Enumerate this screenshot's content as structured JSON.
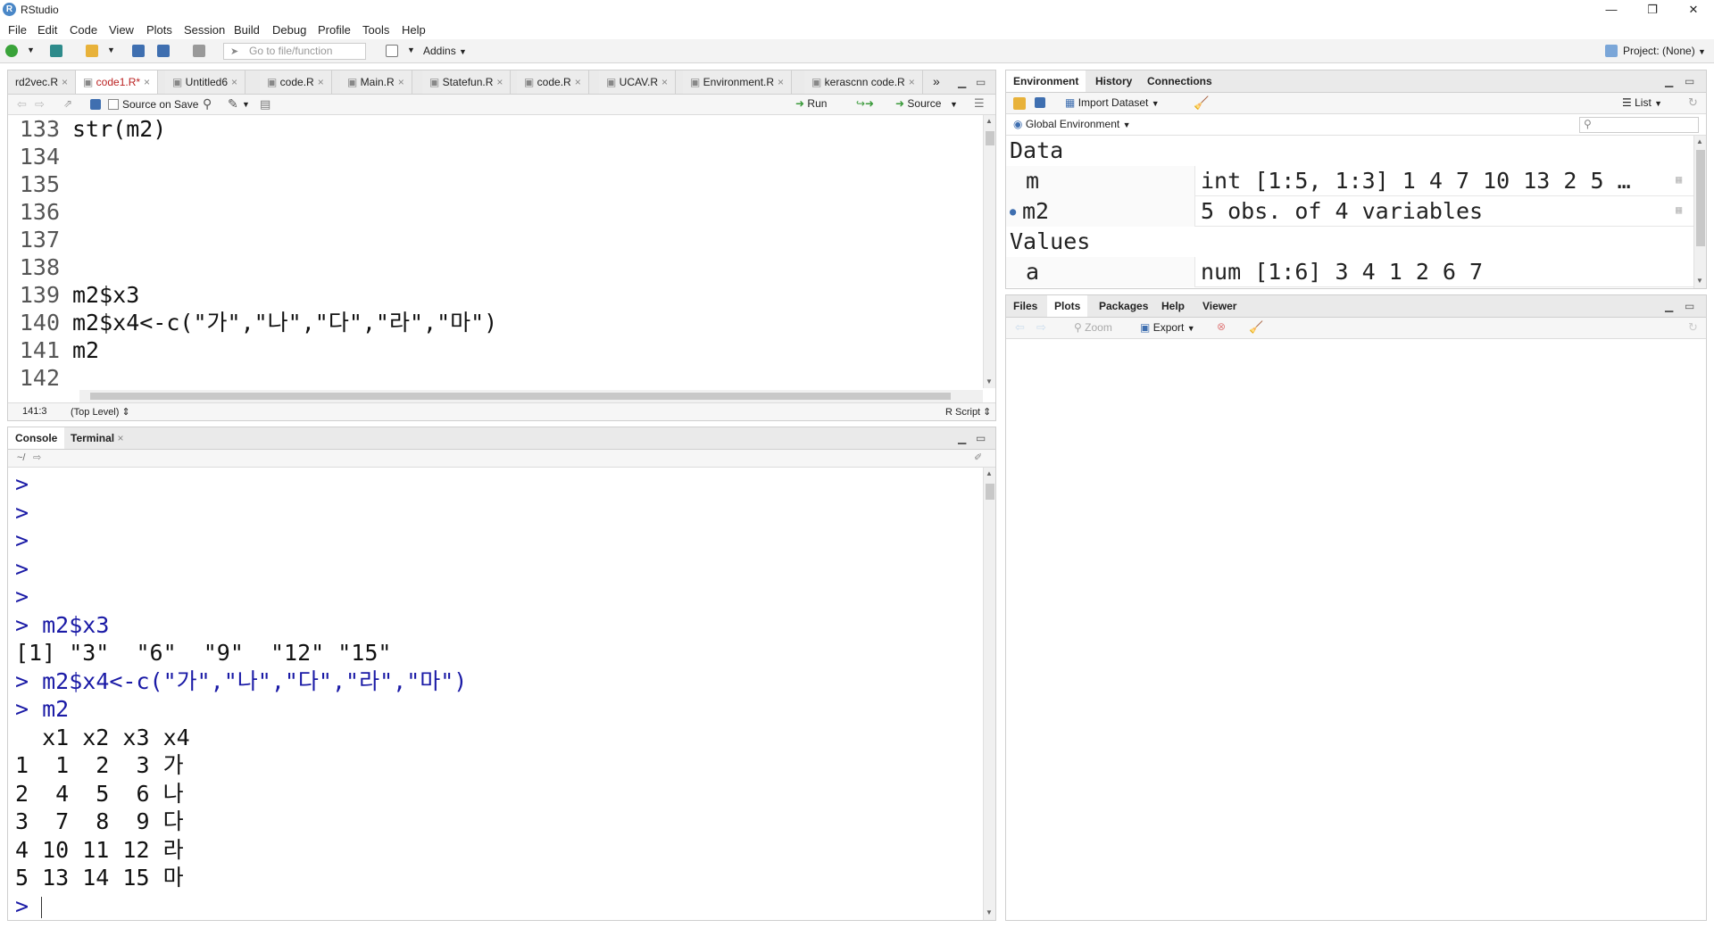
{
  "window": {
    "title": "RStudio",
    "logo": "R"
  },
  "menu": [
    "File",
    "Edit",
    "Code",
    "View",
    "Plots",
    "Session",
    "Build",
    "Debug",
    "Profile",
    "Tools",
    "Help"
  ],
  "toolbar": {
    "goto_placeholder": "Go to file/function",
    "addins": "Addins",
    "project": "Project: (None)"
  },
  "editor": {
    "tabs": [
      {
        "label": "rd2vec.R",
        "active": false
      },
      {
        "label": "code1.R*",
        "active": true
      },
      {
        "label": "Untitled6",
        "active": false
      },
      {
        "label": "code.R",
        "active": false
      },
      {
        "label": "Main.R",
        "active": false
      },
      {
        "label": "Statefun.R",
        "active": false
      },
      {
        "label": "code.R",
        "active": false
      },
      {
        "label": "UCAV.R",
        "active": false
      },
      {
        "label": "Environment.R",
        "active": false
      },
      {
        "label": "kerascnn code.R",
        "active": false
      }
    ],
    "source_on_save": "Source on Save",
    "run": "Run",
    "source": "Source",
    "lines": [
      {
        "n": "133",
        "code": "str(m2)"
      },
      {
        "n": "134",
        "code": ""
      },
      {
        "n": "135",
        "code": ""
      },
      {
        "n": "136",
        "code": ""
      },
      {
        "n": "137",
        "code": ""
      },
      {
        "n": "138",
        "code": ""
      },
      {
        "n": "139",
        "code": "m2$x3"
      },
      {
        "n": "140",
        "code": "m2$x4<-c(\"가\",\"나\",\"다\",\"라\",\"마\")"
      },
      {
        "n": "141",
        "code": "m2"
      },
      {
        "n": "142",
        "code": ""
      }
    ],
    "status": {
      "position": "141:3",
      "scope": "(Top Level)",
      "filetype": "R Script"
    }
  },
  "console": {
    "tabs": [
      "Console",
      "Terminal"
    ],
    "path": "~/",
    "lines": [
      {
        "prompt": ">",
        "text": ""
      },
      {
        "prompt": ">",
        "text": ""
      },
      {
        "prompt": ">",
        "text": ""
      },
      {
        "prompt": ">",
        "text": ""
      },
      {
        "prompt": ">",
        "text": ""
      },
      {
        "prompt": ">",
        "text": " m2$x3"
      },
      {
        "prompt": "",
        "text": "[1] \"3\"  \"6\"  \"9\"  \"12\" \"15\""
      },
      {
        "prompt": ">",
        "text": " m2$x4<-c(\"가\",\"나\",\"다\",\"라\",\"마\")"
      },
      {
        "prompt": ">",
        "text": " m2"
      },
      {
        "prompt": "",
        "text": "  x1 x2 x3 x4"
      },
      {
        "prompt": "",
        "text": "1  1  2  3 가"
      },
      {
        "prompt": "",
        "text": "2  4  5  6 나"
      },
      {
        "prompt": "",
        "text": "3  7  8  9 다"
      },
      {
        "prompt": "",
        "text": "4 10 11 12 라"
      },
      {
        "prompt": "",
        "text": "5 13 14 15 마"
      },
      {
        "prompt": ">",
        "text": ""
      }
    ]
  },
  "environment": {
    "tabs": [
      "Environment",
      "History",
      "Connections"
    ],
    "import": "Import Dataset",
    "view_mode": "List",
    "scope": "Global Environment",
    "sections": [
      {
        "title": "Data",
        "rows": [
          {
            "name": "m",
            "value": "int [1:5, 1:3] 1 4 7 10 13 2 5 …"
          },
          {
            "name": "m2",
            "value": "5 obs. of 4 variables"
          }
        ]
      },
      {
        "title": "Values",
        "rows": [
          {
            "name": "a",
            "value": "num [1:6] 3 4 1 2 6 7"
          }
        ]
      }
    ]
  },
  "files": {
    "tabs": [
      "Files",
      "Plots",
      "Packages",
      "Help",
      "Viewer"
    ],
    "zoom": "Zoom",
    "export": "Export"
  }
}
